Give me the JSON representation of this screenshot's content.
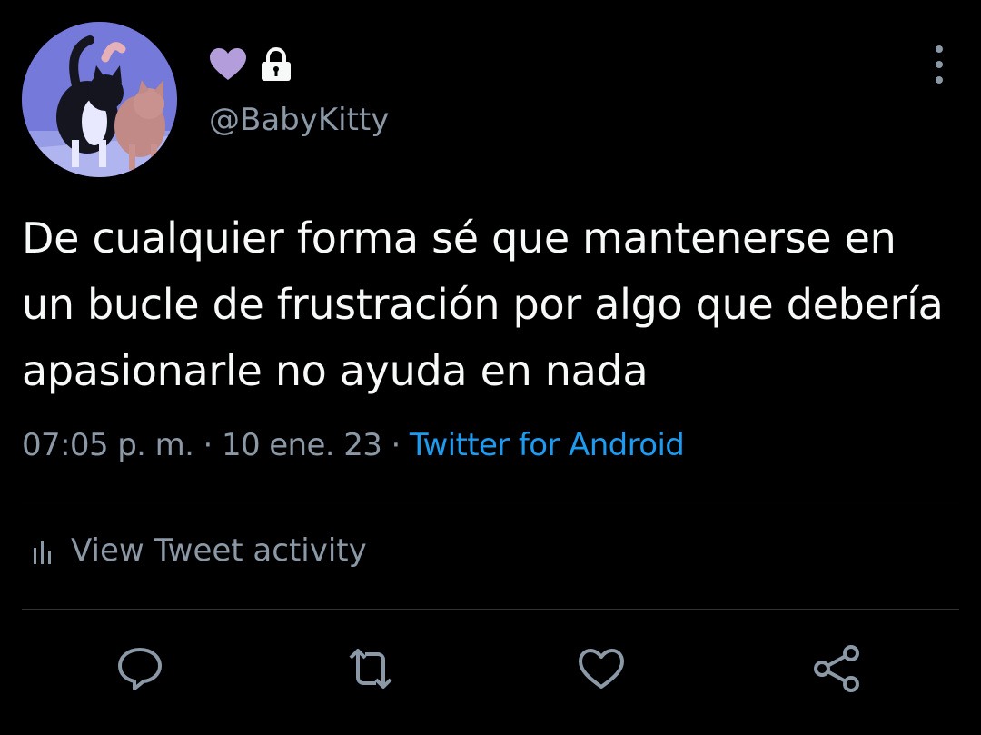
{
  "user": {
    "avatar_description": "avatar",
    "name_emoji": "purple-heart",
    "protected_icon": "lock-icon",
    "handle": "@BabyKitty"
  },
  "tweet": {
    "text": "De cualquier forma sé que mantenerse en un bucle de frustración por algo que debería apasionarle no ayuda en nada",
    "time": "07:05 p. m.",
    "separator": " · ",
    "date": "10 ene. 23",
    "source": "Twitter for Android"
  },
  "activity": {
    "icon": "bar-chart-icon",
    "label": "View Tweet activity"
  },
  "actions": [
    "reply-icon",
    "retweet-icon",
    "like-icon",
    "share-icon"
  ],
  "colors": {
    "background": "#000000",
    "text": "#f7f9f9",
    "secondary": "#8b98a5",
    "link": "#1d9bf0",
    "heart": "#b39ddb",
    "divider": "#2f3336"
  }
}
